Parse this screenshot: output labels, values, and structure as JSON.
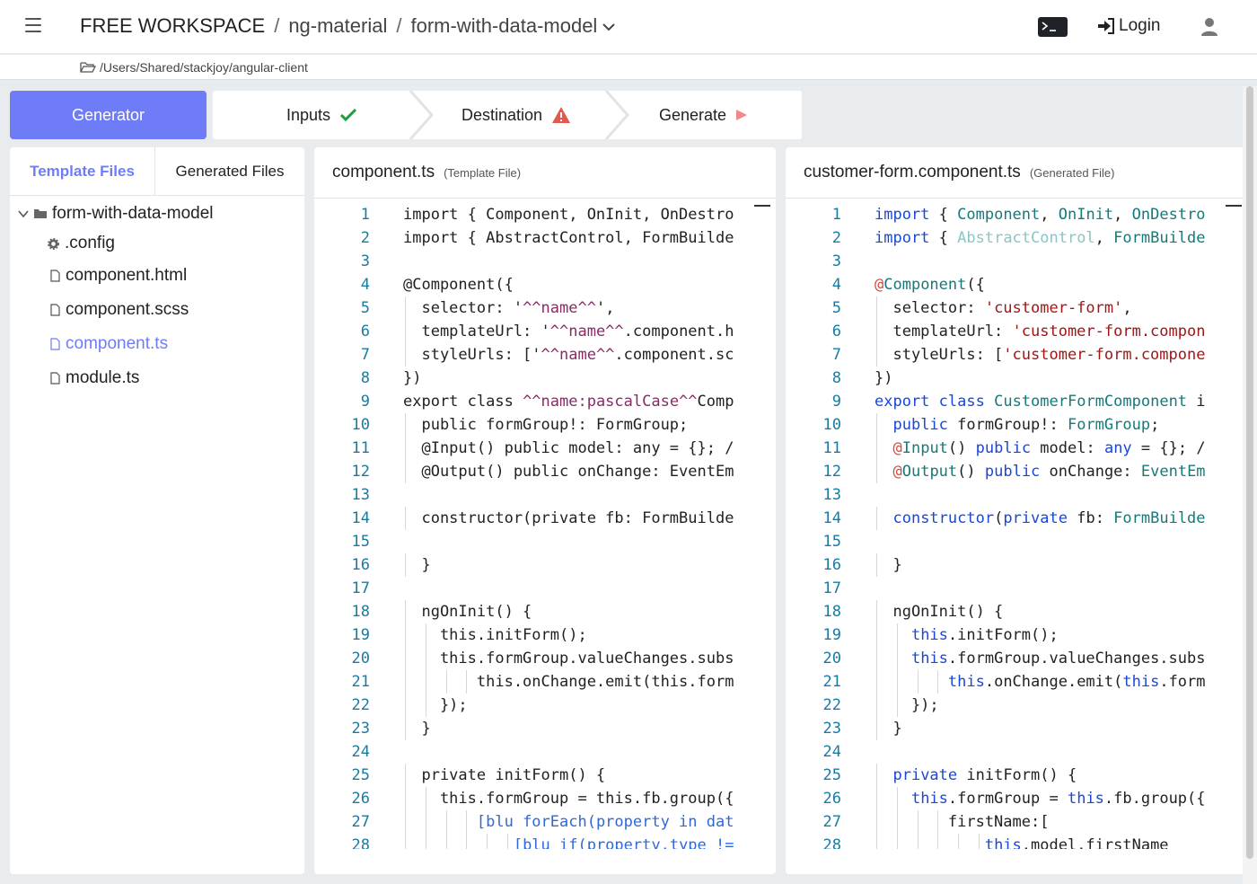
{
  "header": {
    "breadcrumbs": [
      "FREE WORKSPACE",
      "ng-material",
      "form-with-data-model"
    ],
    "login_label": "Login",
    "path": "/Users/Shared/stackjoy/angular-client"
  },
  "steps": {
    "generator": "Generator",
    "inputs": "Inputs",
    "destination": "Destination",
    "generate": "Generate"
  },
  "files": {
    "tabs": [
      "Template Files",
      "Generated Files"
    ],
    "folder": "form-with-data-model",
    "items": [
      ".config",
      "component.html",
      "component.scss",
      "component.ts",
      "module.ts"
    ],
    "active_item": "component.ts"
  },
  "left_panel": {
    "title": "component.ts",
    "subtitle": "(Template File)",
    "lines": [
      "import { Component, OnInit, OnDestro",
      "import { AbstractControl, FormBuilde",
      "",
      "@Component({",
      "  selector: '^^name^^',",
      "  templateUrl: '^^name^^.component.h",
      "  styleUrls: ['^^name^^.component.sc",
      "})",
      "export class ^^name:pascalCase^^Comp",
      "  public formGroup!: FormGroup;",
      "  @Input() public model: any = {}; /",
      "  @Output() public onChange: EventEm",
      "",
      "  constructor(private fb: FormBuilde",
      "",
      "  }",
      "",
      "  ngOnInit() {",
      "    this.initForm();",
      "    this.formGroup.valueChanges.subs",
      "        this.onChange.emit(this.form",
      "    });",
      "  }",
      "",
      "  private initForm() {",
      "    this.formGroup = this.fb.group({",
      "        [blu forEach(property in dat",
      "            [blu if(property.type !="
    ]
  },
  "right_panel": {
    "title": "customer-form.component.ts",
    "subtitle": "(Generated File)",
    "lines": [
      "import { Component, OnInit, OnDestro",
      "import { AbstractControl, FormBuilde",
      "",
      "@Component({",
      "  selector: 'customer-form',",
      "  templateUrl: 'customer-form.compon",
      "  styleUrls: ['customer-form.compone",
      "})",
      "export class CustomerFormComponent i",
      "  public formGroup!: FormGroup;",
      "  @Input() public model: any = {}; /",
      "  @Output() public onChange: EventEm",
      "",
      "  constructor(private fb: FormBuilde",
      "",
      "  }",
      "",
      "  ngOnInit() {",
      "    this.initForm();",
      "    this.formGroup.valueChanges.subs",
      "        this.onChange.emit(this.form",
      "    });",
      "  }",
      "",
      "  private initForm() {",
      "    this.formGroup = this.fb.group({",
      "        firstName:[",
      "            this.model.firstName"
    ]
  },
  "colors": {
    "accent": "#6f7cf7",
    "success": "#1f9d3a",
    "warning": "#e05a4f",
    "keyword": "#1948d6",
    "type": "#147a7a",
    "string": "#a31515",
    "template_var": "#8a2a66",
    "line_number": "#1a7aa0"
  }
}
